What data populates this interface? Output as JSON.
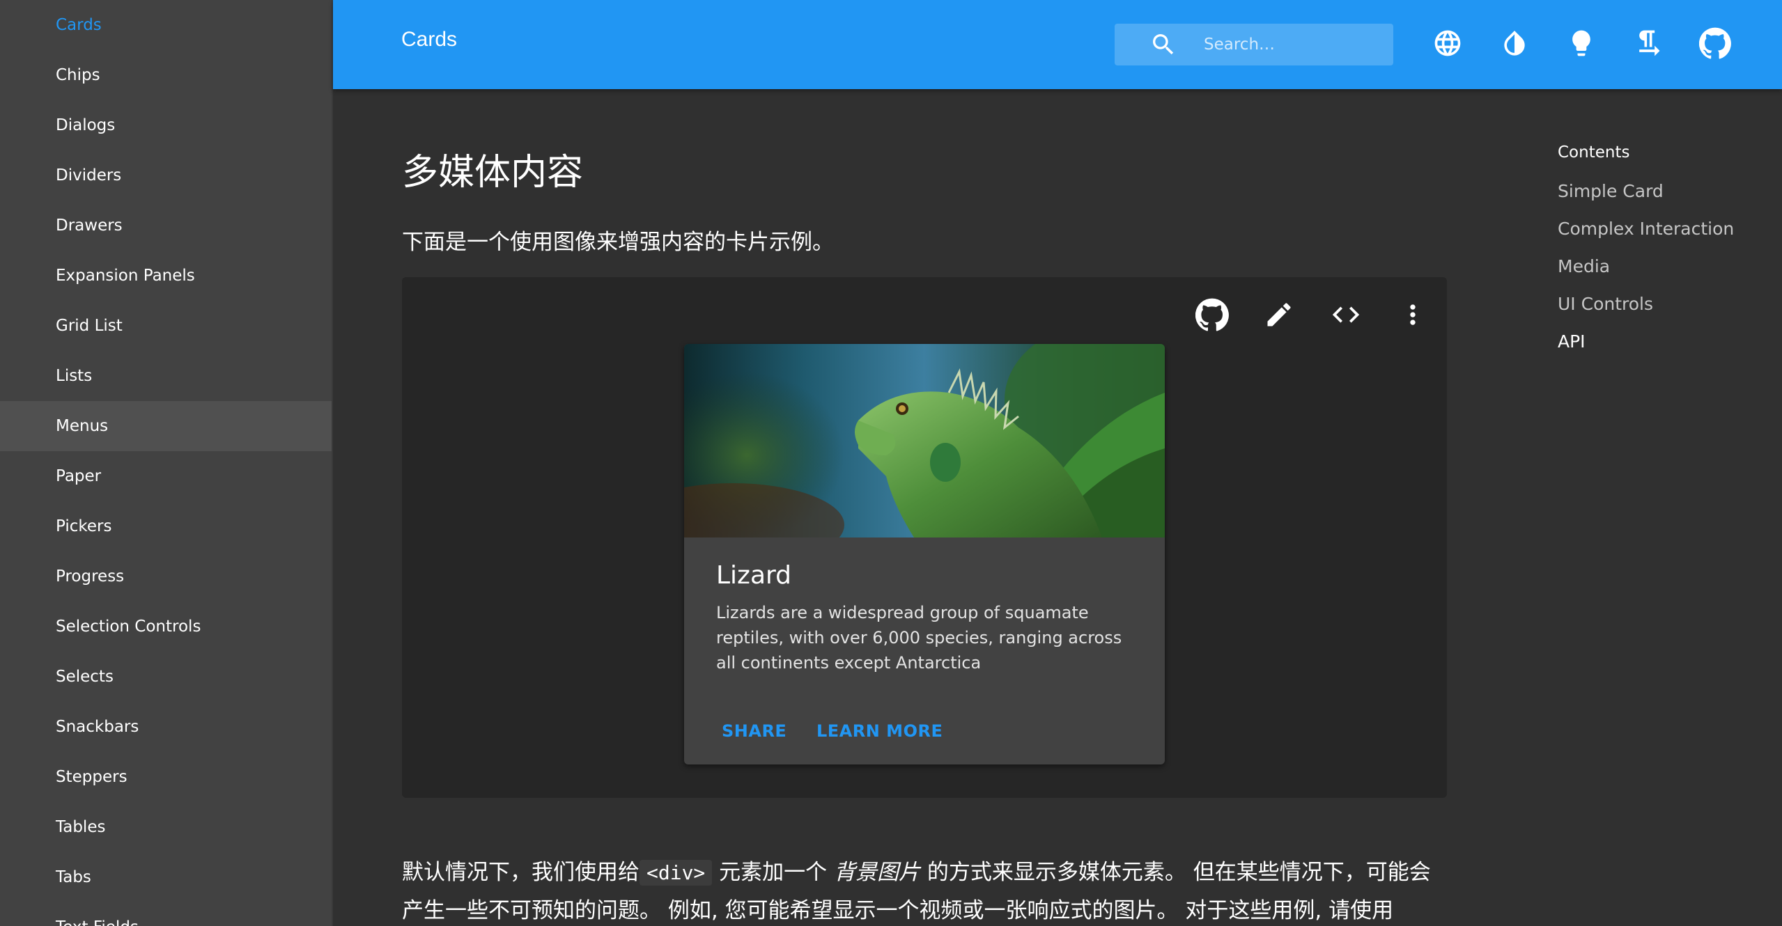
{
  "sidebar": {
    "items": [
      {
        "label": "Cards"
      },
      {
        "label": "Chips"
      },
      {
        "label": "Dialogs"
      },
      {
        "label": "Dividers"
      },
      {
        "label": "Drawers"
      },
      {
        "label": "Expansion Panels"
      },
      {
        "label": "Grid List"
      },
      {
        "label": "Lists"
      },
      {
        "label": "Menus"
      },
      {
        "label": "Paper"
      },
      {
        "label": "Pickers"
      },
      {
        "label": "Progress"
      },
      {
        "label": "Selection Controls"
      },
      {
        "label": "Selects"
      },
      {
        "label": "Snackbars"
      },
      {
        "label": "Steppers"
      },
      {
        "label": "Tables"
      },
      {
        "label": "Tabs"
      },
      {
        "label": "Text Fields"
      }
    ],
    "active_item": "Cards",
    "hover_item": "Menus"
  },
  "header": {
    "title": "Cards",
    "search_placeholder": "Search…",
    "icons": [
      "search-icon",
      "language-icon",
      "invert-colors-icon",
      "lightbulb-icon",
      "text-direction-icon",
      "github-icon"
    ]
  },
  "main": {
    "heading": "多媒体内容",
    "intro": "下面是一个使用图像来增强内容的卡片示例。",
    "demo_tools": [
      "github-icon",
      "edit-icon",
      "code-icon",
      "more-vert-icon"
    ],
    "card": {
      "title": "Lizard",
      "text": "Lizards are a widespread group of squamate reptiles, with over 6,000 species, ranging across all continents except Antarctica",
      "actions": [
        "SHARE",
        "LEARN MORE"
      ]
    },
    "body": {
      "part1": "默认情况下，我们使用给",
      "code": "<div>",
      "part2": " 元素加一个 ",
      "emphasis": "背景图片",
      "part3": " 的方式来显示多媒体元素。 但在某些情况下，可能会产生一些不可预知的问题。 例如, 您可能希望显示一个视频或一张响应式的图片。 对于这些用例, 请使用"
    }
  },
  "toc": {
    "title": "Contents",
    "items": [
      "Simple Card",
      "Complex Interaction",
      "Media",
      "UI Controls",
      "API"
    ],
    "current": "API"
  },
  "colors": {
    "primary": "#2196f3",
    "sidebar_bg": "#424242",
    "page_bg": "#303030",
    "demo_bg": "#262626",
    "card_bg": "#424242"
  }
}
